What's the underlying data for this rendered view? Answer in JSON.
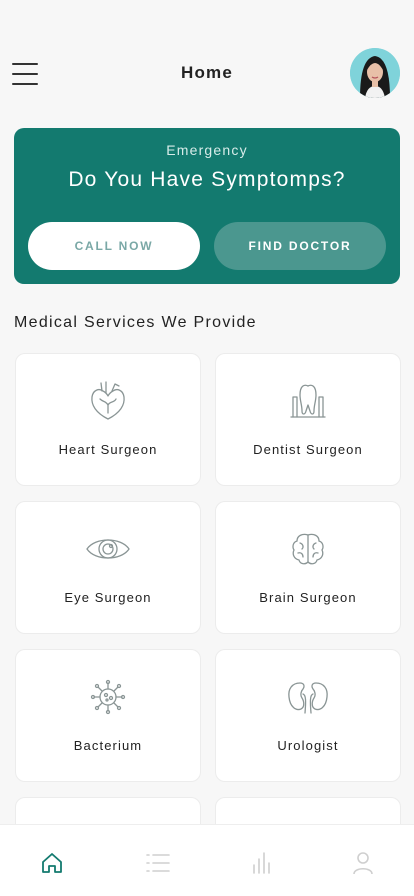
{
  "header": {
    "title": "Home"
  },
  "emergency": {
    "subtitle": "Emergency",
    "title": "Do You Have Symptomps?",
    "call_label": "CALL NOW",
    "find_label": "FIND DOCTOR"
  },
  "services": {
    "title": "Medical Services We Provide",
    "items": [
      {
        "label": "Heart Surgeon",
        "icon": "heart-icon"
      },
      {
        "label": "Dentist Surgeon",
        "icon": "tooth-icon"
      },
      {
        "label": "Eye Surgeon",
        "icon": "eye-icon"
      },
      {
        "label": "Brain Surgeon",
        "icon": "brain-icon"
      },
      {
        "label": "Bacterium",
        "icon": "bacterium-icon"
      },
      {
        "label": "Urologist",
        "icon": "kidney-icon"
      }
    ]
  },
  "nav": {
    "items": [
      "home-icon",
      "list-icon",
      "chart-icon",
      "profile-icon"
    ]
  },
  "colors": {
    "accent": "#137a6f",
    "find_button": "#4b978f",
    "call_text": "#7aa8a6",
    "icon_stroke": "#8a9595"
  }
}
